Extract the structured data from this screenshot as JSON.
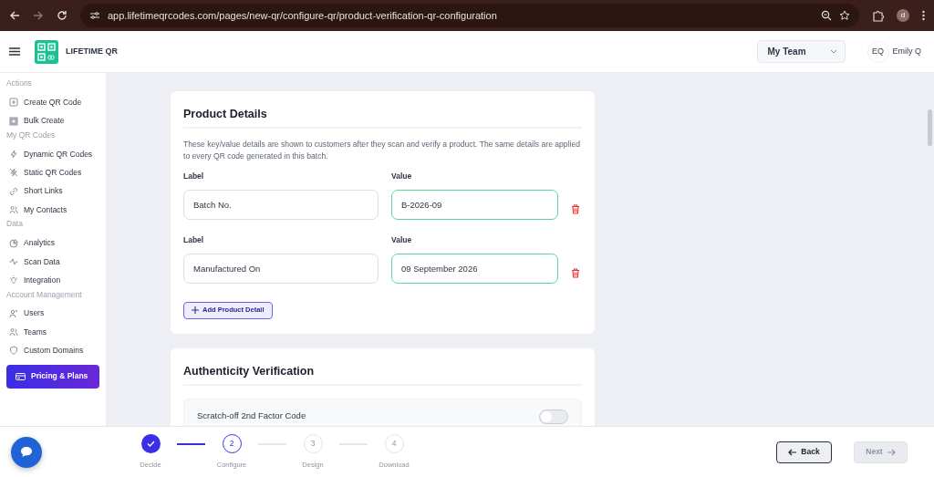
{
  "browser": {
    "url": "app.lifetimeqrcodes.com/pages/new-qr/configure-qr/product-verification-qr-configuration",
    "profile_initial": "d"
  },
  "header": {
    "brand": "LIFETIME QR",
    "team_select": {
      "value": "My Team"
    },
    "user": {
      "initials": "EQ",
      "name": "Emily Q"
    }
  },
  "sidebar": {
    "sections": [
      {
        "title": "Actions",
        "items": [
          {
            "label": "Create QR Code"
          },
          {
            "label": "Bulk Create"
          }
        ]
      },
      {
        "title": "My QR Codes",
        "items": [
          {
            "label": "Dynamic QR Codes"
          },
          {
            "label": "Static QR Codes"
          },
          {
            "label": "Short Links"
          },
          {
            "label": "My Contacts"
          }
        ]
      },
      {
        "title": "Data",
        "items": [
          {
            "label": "Analytics"
          },
          {
            "label": "Scan Data"
          },
          {
            "label": "Integration"
          }
        ]
      },
      {
        "title": "Account Management",
        "items": [
          {
            "label": "Users"
          },
          {
            "label": "Teams"
          },
          {
            "label": "Custom Domains"
          }
        ]
      }
    ],
    "pricing_button": "Pricing & Plans"
  },
  "product_details": {
    "title": "Product Details",
    "description": "These key/value details are shown to customers after they scan and verify a product. The same details are applied to every QR code generated in this batch.",
    "rows": [
      {
        "label_caption": "Label",
        "label_value": "Batch No.",
        "value_caption": "Value",
        "value": "B-2026-09"
      },
      {
        "label_caption": "Label",
        "label_value": "Manufactured On",
        "value_caption": "Value",
        "value": "09 September 2026"
      }
    ],
    "add_button": "Add Product Detail"
  },
  "authenticity": {
    "title": "Authenticity Verification",
    "options": [
      {
        "label": "Scratch-off 2nd Factor Code",
        "on": false
      }
    ]
  },
  "steps": [
    {
      "label": "Decide",
      "done": true,
      "selected": false
    },
    {
      "number": "2",
      "label": "Configure",
      "done": false,
      "selected": true
    },
    {
      "number": "3",
      "label": "Design",
      "done": false,
      "selected": false
    },
    {
      "number": "4",
      "label": "Download",
      "done": false,
      "selected": false
    }
  ],
  "back_button": "Back",
  "next_button": {
    "label": "Next",
    "disabled": true
  }
}
